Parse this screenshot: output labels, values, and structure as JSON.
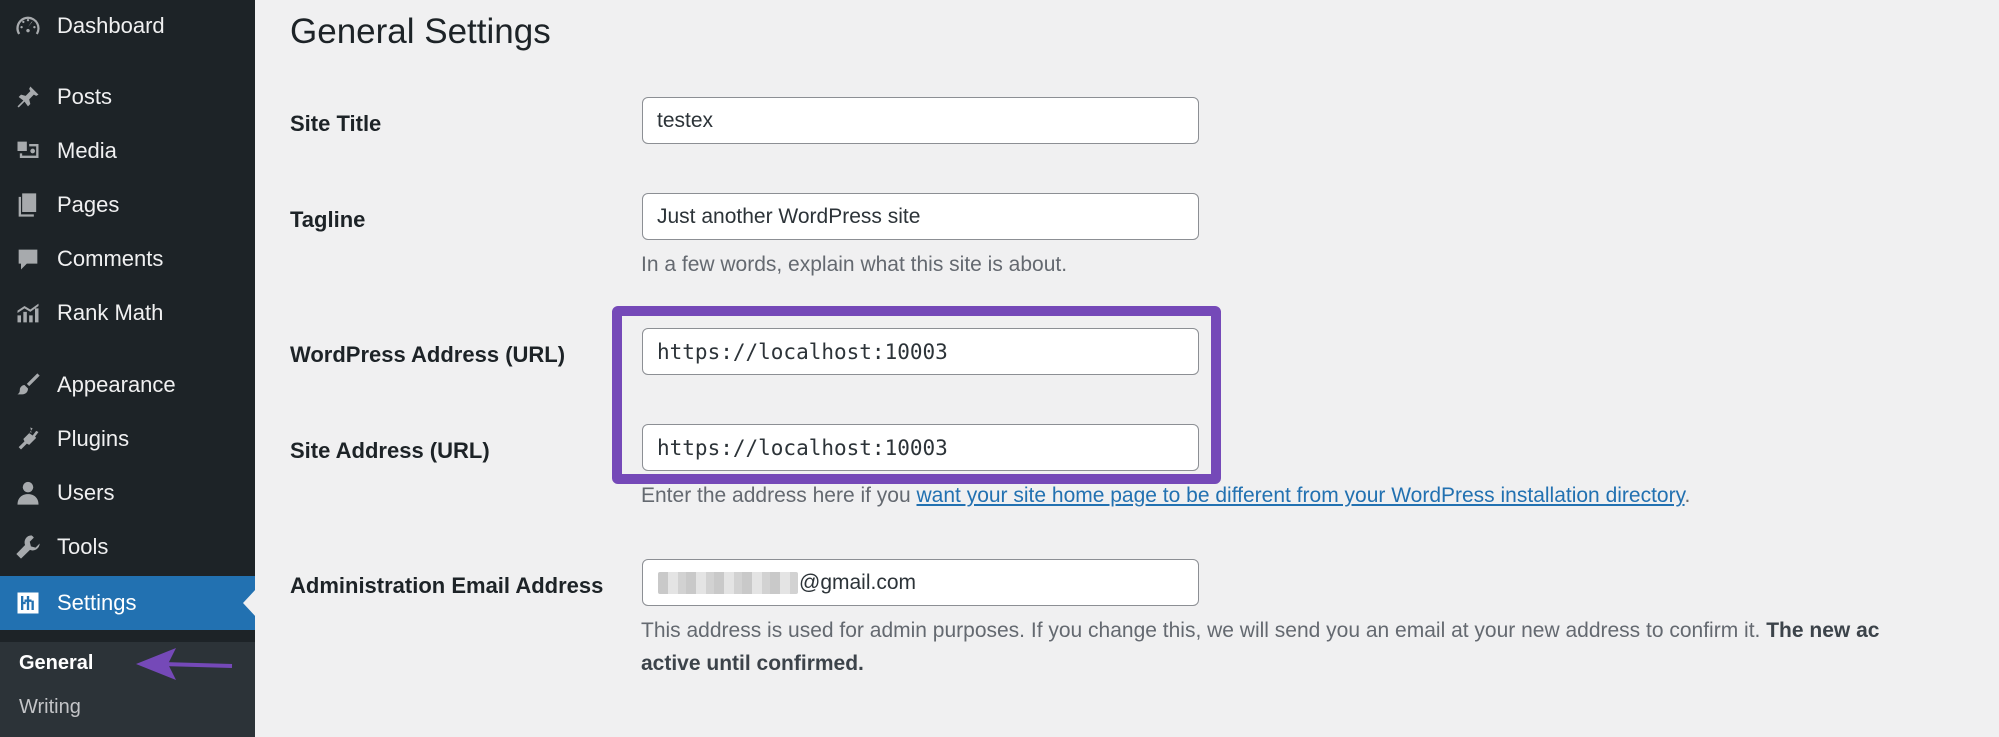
{
  "sidebar": {
    "items": [
      {
        "label": "Dashboard",
        "icon": "dashboard-icon"
      },
      {
        "label": "Posts",
        "icon": "pin-icon"
      },
      {
        "label": "Media",
        "icon": "media-icon"
      },
      {
        "label": "Pages",
        "icon": "pages-icon"
      },
      {
        "label": "Comments",
        "icon": "comment-icon"
      },
      {
        "label": "Rank Math",
        "icon": "chart-icon"
      },
      {
        "label": "Appearance",
        "icon": "brush-icon"
      },
      {
        "label": "Plugins",
        "icon": "plug-icon"
      },
      {
        "label": "Users",
        "icon": "user-icon"
      },
      {
        "label": "Tools",
        "icon": "wrench-icon"
      },
      {
        "label": "Settings",
        "icon": "settings-icon",
        "active": true
      }
    ],
    "submenu": [
      {
        "label": "General",
        "current": true
      },
      {
        "label": "Writing"
      }
    ]
  },
  "page": {
    "title": "General Settings",
    "site_title": {
      "label": "Site Title",
      "value": "testex"
    },
    "tagline": {
      "label": "Tagline",
      "value": "Just another WordPress site",
      "description": "In a few words, explain what this site is about."
    },
    "wp_address": {
      "label": "WordPress Address (URL)",
      "value": "https://localhost:10003"
    },
    "site_address": {
      "label": "Site Address (URL)",
      "value": "https://localhost:10003",
      "description_prefix": "Enter the address here if you ",
      "description_link": "want your site home page to be different from your WordPress installation directory",
      "description_suffix": "."
    },
    "admin_email": {
      "label": "Administration Email Address",
      "value_visible": "@gmail.com",
      "description_line1": "This address is used for admin purposes. If you change this, we will send you an email at your new address to confirm it.",
      "description_bold1": "The new ac",
      "description_bold2": "active until confirmed."
    }
  },
  "colors": {
    "sidebar_bg": "#1d2327",
    "active_menu": "#2271b1",
    "highlight": "#7549b8",
    "link": "#2271b1"
  }
}
